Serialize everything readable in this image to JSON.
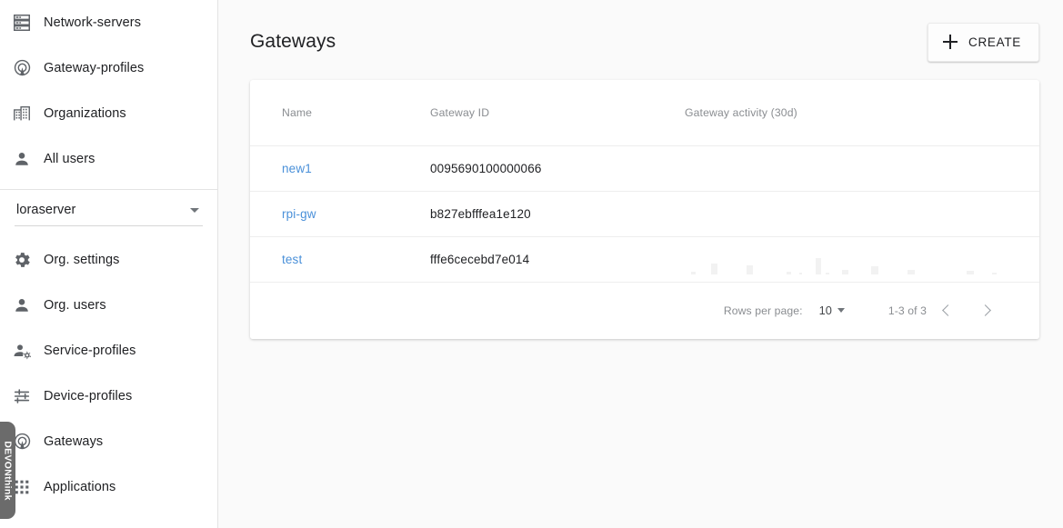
{
  "sidebar": {
    "top_items": [
      {
        "label": "Network-servers",
        "icon": "storage-icon"
      },
      {
        "label": "Gateway-profiles",
        "icon": "router-icon"
      },
      {
        "label": "Organizations",
        "icon": "business-icon"
      },
      {
        "label": "All users",
        "icon": "person-icon"
      }
    ],
    "org_selector": {
      "value": "loraserver",
      "icon": "chevron-down-icon"
    },
    "bottom_items": [
      {
        "label": "Org. settings",
        "icon": "settings-gear-icon"
      },
      {
        "label": "Org. users",
        "icon": "person-icon"
      },
      {
        "label": "Service-profiles",
        "icon": "person-gear-icon"
      },
      {
        "label": "Device-profiles",
        "icon": "tune-sliders-icon"
      },
      {
        "label": "Gateways",
        "icon": "router-icon"
      },
      {
        "label": "Applications",
        "icon": "apps-grid-icon"
      }
    ],
    "side_tab": {
      "label": "DEVONthink"
    }
  },
  "header": {
    "title": "Gateways",
    "create_label": "CREATE",
    "create_icon": "plus-icon"
  },
  "table": {
    "columns": [
      "Name",
      "Gateway ID",
      "Gateway activity (30d)"
    ],
    "rows": [
      {
        "name": "new1",
        "gateway_id": "0095690100000066",
        "activity": []
      },
      {
        "name": "rpi-gw",
        "gateway_id": "b827ebfffea1e120",
        "activity": []
      },
      {
        "name": "test",
        "gateway_id": "fffe6cecebd7e014",
        "activity": [
          {
            "x": 2,
            "h": 3,
            "w": 5
          },
          {
            "x": 8,
            "h": 12,
            "w": 7
          },
          {
            "x": 19,
            "h": 10,
            "w": 7
          },
          {
            "x": 31,
            "h": 3,
            "w": 5
          },
          {
            "x": 43,
            "h": 2,
            "w": 4
          },
          {
            "x": 35,
            "h": 2,
            "w": 3
          },
          {
            "x": 40,
            "h": 18,
            "w": 6
          },
          {
            "x": 48,
            "h": 5,
            "w": 7
          },
          {
            "x": 57,
            "h": 9,
            "w": 8
          },
          {
            "x": 68,
            "h": 5,
            "w": 8
          },
          {
            "x": 86,
            "h": 4,
            "w": 8
          },
          {
            "x": 94,
            "h": 2,
            "w": 5
          }
        ]
      }
    ]
  },
  "pagination": {
    "rows_per_page_label": "Rows per page:",
    "rows_per_page_value": "10",
    "range_label": "1-3 of 3",
    "prev_icon": "chevron-left-icon",
    "next_icon": "chevron-right-icon"
  },
  "colors": {
    "link": "#4a90d9",
    "page_bg": "#fafafa",
    "card_bg": "#ffffff",
    "icon": "#5f6368",
    "muted_text": "#8a8d91"
  }
}
